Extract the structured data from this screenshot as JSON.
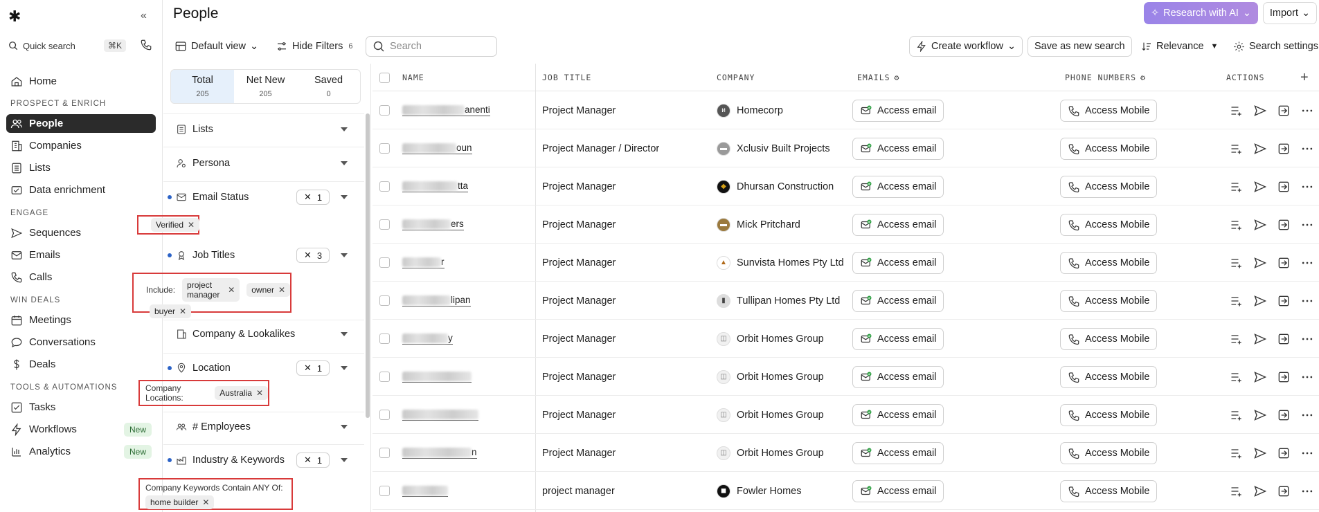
{
  "nav": {
    "quick_search": "Quick search",
    "quick_search_kbd": "⌘K",
    "items": {
      "home": "Home",
      "people": "People",
      "companies": "Companies",
      "lists": "Lists",
      "data_enrichment": "Data enrichment",
      "sequences": "Sequences",
      "emails": "Emails",
      "calls": "Calls",
      "meetings": "Meetings",
      "conversations": "Conversations",
      "deals": "Deals",
      "tasks": "Tasks",
      "workflows": "Workflows",
      "analytics": "Analytics"
    },
    "sections": {
      "prospect": "PROSPECT & ENRICH",
      "engage": "ENGAGE",
      "win": "WIN DEALS",
      "tools": "TOOLS & AUTOMATIONS"
    },
    "new_badge": "New"
  },
  "header": {
    "title": "People",
    "research_label": "Research with AI",
    "import_label": "Import"
  },
  "toolbar": {
    "default_view": "Default view",
    "hide_filters": "Hide Filters",
    "filter_count": "6",
    "search_placeholder": "Search",
    "create_workflow": "Create workflow",
    "save_search": "Save as new search",
    "relevance": "Relevance",
    "search_settings": "Search settings"
  },
  "tabs": [
    {
      "label": "Total",
      "count": "205"
    },
    {
      "label": "Net New",
      "count": "205"
    },
    {
      "label": "Saved",
      "count": "0"
    }
  ],
  "filters": {
    "lists": "Lists",
    "persona": "Persona",
    "email_status": {
      "label": "Email Status",
      "count": "1",
      "value": "Verified"
    },
    "job_titles": {
      "label": "Job Titles",
      "count": "3",
      "include_label": "Include:",
      "values": [
        "project manager",
        "owner",
        "buyer"
      ]
    },
    "company_lookalikes": "Company & Lookalikes",
    "location": {
      "label": "Location",
      "count": "1",
      "prefix": "Company Locations:",
      "value": "Australia"
    },
    "employees": "# Employees",
    "industry": {
      "label": "Industry & Keywords",
      "count": "1",
      "prefix": "Company Keywords Contain ANY Of:",
      "value": "home builder"
    }
  },
  "table": {
    "columns": {
      "name": "NAME",
      "job_title": "JOB TITLE",
      "company": "COMPANY",
      "emails": "EMAILS",
      "phones": "PHONE NUMBERS",
      "actions": "ACTIONS"
    },
    "access_email": "Access email",
    "access_mobile": "Access Mobile",
    "rows": [
      {
        "name_tail": "anenti",
        "job": "Project Manager",
        "company": "Homecorp"
      },
      {
        "name_tail": "oun",
        "job": "Project Manager / Director",
        "company": "Xclusiv Built Projects"
      },
      {
        "name_tail": "tta",
        "job": "Project Manager",
        "company": "Dhursan Construction"
      },
      {
        "name_tail": "ers",
        "job": "Project Manager",
        "company": "Mick Pritchard"
      },
      {
        "name_tail": "r",
        "job": "Project Manager",
        "company": "Sunvista Homes Pty Ltd"
      },
      {
        "name_tail": "lipan",
        "job": "Project Manager",
        "company": "Tullipan Homes Pty Ltd"
      },
      {
        "name_tail": "y",
        "job": "Project Manager",
        "company": "Orbit Homes Group"
      },
      {
        "name_tail": "",
        "job": "Project Manager",
        "company": "Orbit Homes Group"
      },
      {
        "name_tail": "",
        "job": "Project Manager",
        "company": "Orbit Homes Group"
      },
      {
        "name_tail": "n",
        "job": "Project Manager",
        "company": "Orbit Homes Group"
      },
      {
        "name_tail": "",
        "job": "project manager",
        "company": "Fowler Homes"
      }
    ]
  }
}
